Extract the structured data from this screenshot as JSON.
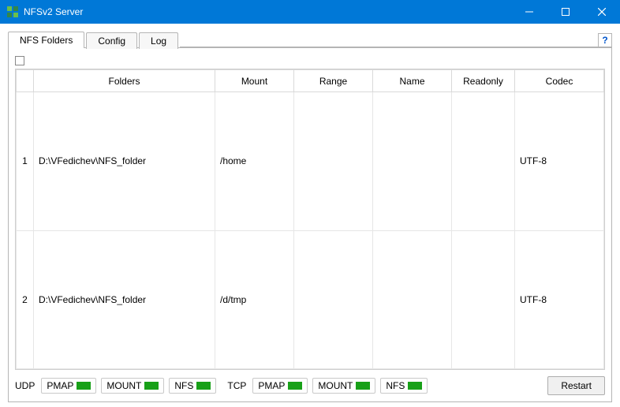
{
  "window": {
    "title": "NFSv2 Server"
  },
  "tabs": [
    "NFS Folders",
    "Config",
    "Log"
  ],
  "activeTab": 0,
  "help": "?",
  "columns": [
    "Folders",
    "Mount",
    "Range",
    "Name",
    "Readonly",
    "Codec"
  ],
  "rows": [
    {
      "n": "1",
      "folders": "D:\\VFedichev\\NFS_folder",
      "mount": "/home",
      "range": "",
      "name": "",
      "readonly": "",
      "codec": "UTF-8"
    },
    {
      "n": "2",
      "folders": "D:\\VFedichev\\NFS_folder",
      "mount": "/d/tmp",
      "range": "",
      "name": "",
      "readonly": "",
      "codec": "UTF-8"
    }
  ],
  "status": {
    "udpLabel": "UDP",
    "tcpLabel": "TCP",
    "udp": [
      "PMAP",
      "MOUNT",
      "NFS"
    ],
    "tcp": [
      "PMAP",
      "MOUNT",
      "NFS"
    ]
  },
  "buttons": {
    "restart": "Restart"
  }
}
